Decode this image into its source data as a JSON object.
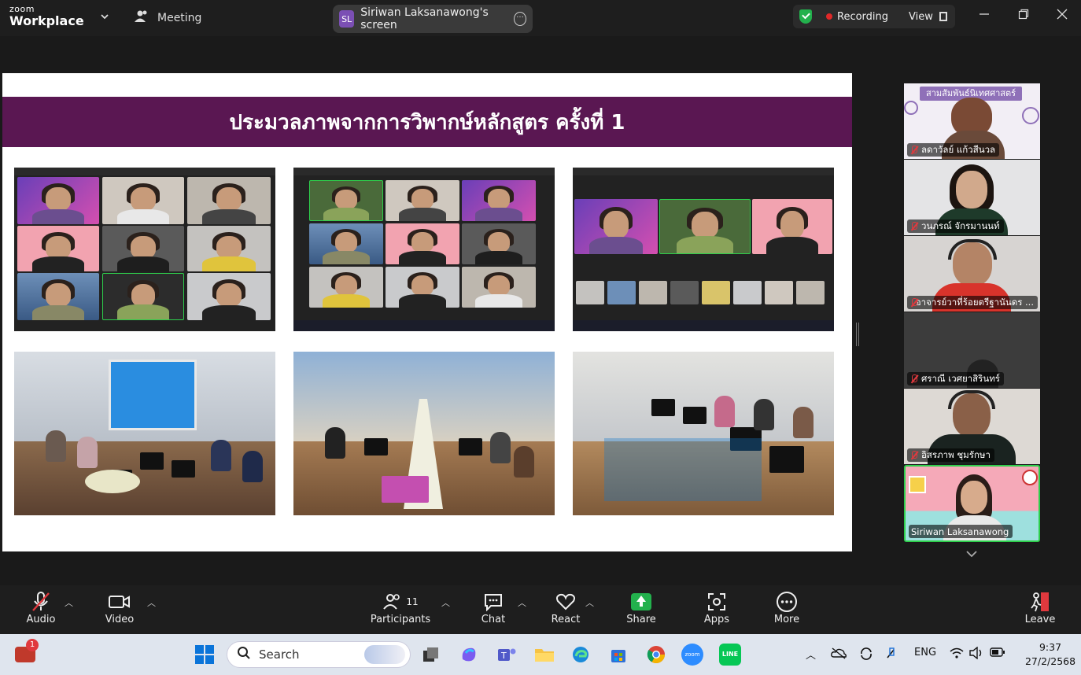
{
  "topbar": {
    "logo_small": "zoom",
    "logo_big": "Workplace",
    "meeting_label": "Meeting",
    "share_initials": "SL",
    "share_label": "Siriwan Laksanawong's screen",
    "recording_label": "Recording",
    "view_label": "View"
  },
  "slide": {
    "title": "ประมวลภาพจากการวิพากษ์หลักสูตร ครั้งที่ 1"
  },
  "gallery": {
    "banner_text": "สามสัมพันธ์นิเทศศาสตร์",
    "participants": [
      {
        "name": "ลดาวัลย์ แก้วสีนวล",
        "muted": true
      },
      {
        "name": "วนภรณ์ จักรมานนท์",
        "muted": true
      },
      {
        "name": "อาจารย์วาที่ร้อยตรีฐานันดร ...",
        "muted": true
      },
      {
        "name": "ศราณี เวศยาสิรินทร์",
        "muted": true
      },
      {
        "name": "อิสรภาพ ชุมรักษา",
        "muted": true
      },
      {
        "name": "Siriwan Laksanawong",
        "muted": false
      }
    ]
  },
  "toolbar": {
    "audio": "Audio",
    "video": "Video",
    "participants": "Participants",
    "participants_count": "11",
    "chat": "Chat",
    "react": "React",
    "share": "Share",
    "apps": "Apps",
    "more": "More",
    "leave": "Leave"
  },
  "taskbar": {
    "search_placeholder": "Search",
    "notification_count": "1",
    "language": "ENG",
    "time": "9:37",
    "date": "27/2/2568"
  },
  "colors": {
    "slide_title_bg": "#5a1752",
    "share_green": "#23b14d",
    "active_speaker_border": "#2ecf4c",
    "muted_red": "#e0393e"
  }
}
